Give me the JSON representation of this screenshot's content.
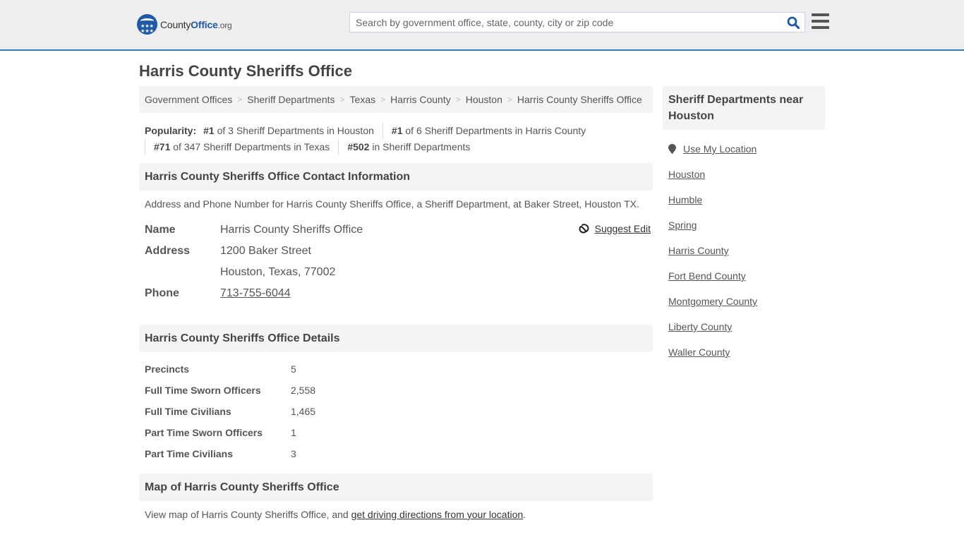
{
  "header": {
    "logo": {
      "prefix": "County",
      "bold": "Office",
      "suffix": ".org"
    },
    "search": {
      "placeholder": "Search by government office, state, county, city or zip code",
      "value": ""
    },
    "icons": {
      "search": "search-icon",
      "menu": "hamburger-menu-icon",
      "logo": "eagle-stars-logo-icon"
    }
  },
  "page": {
    "title": "Harris County Sheriffs Office"
  },
  "breadcrumb": [
    {
      "label": "Government Offices"
    },
    {
      "label": "Sheriff Departments"
    },
    {
      "label": "Texas"
    },
    {
      "label": "Harris County"
    },
    {
      "label": "Houston"
    },
    {
      "label": "Harris County Sheriffs Office"
    }
  ],
  "breadcrumb_separator": ">",
  "popularity": {
    "label": "Popularity:",
    "items": [
      {
        "rank": "#1",
        "text": " of 3 Sheriff Departments in Houston"
      },
      {
        "rank": "#1",
        "text": " of 6 Sheriff Departments in Harris County"
      },
      {
        "rank": "#71",
        "text": " of 347 Sheriff Departments in Texas"
      },
      {
        "rank": "#502",
        "text": " in Sheriff Departments"
      }
    ]
  },
  "contact": {
    "heading": "Harris County Sheriffs Office Contact Information",
    "description": "Address and Phone Number for Harris County Sheriffs Office, a Sheriff Department, at Baker Street, Houston TX.",
    "suggest_edit": "Suggest Edit",
    "name_label": "Name",
    "name_value": "Harris County Sheriffs Office",
    "address_label": "Address",
    "address_line1": "1200 Baker Street",
    "address_line2": "Houston, Texas, 77002",
    "phone_label": "Phone",
    "phone_value": "713-755-6044"
  },
  "details": {
    "heading": "Harris County Sheriffs Office Details",
    "rows": [
      {
        "label": "Precincts",
        "value": "5"
      },
      {
        "label": "Full Time Sworn Officers",
        "value": "2,558"
      },
      {
        "label": "Full Time Civilians",
        "value": "1,465"
      },
      {
        "label": "Part Time Sworn Officers",
        "value": "1"
      },
      {
        "label": "Part Time Civilians",
        "value": "3"
      }
    ]
  },
  "map": {
    "heading": "Map of Harris County Sheriffs Office",
    "text_before": "View map of Harris County Sheriffs Office, and ",
    "link": "get driving directions from your location",
    "text_after": "."
  },
  "sidebar": {
    "heading": "Sheriff Departments near Houston",
    "use_location": "Use My Location",
    "links": [
      {
        "label": "Houston"
      },
      {
        "label": "Humble"
      },
      {
        "label": "Spring"
      },
      {
        "label": "Harris County"
      },
      {
        "label": "Fort Bend County"
      },
      {
        "label": "Montgomery County"
      },
      {
        "label": "Liberty County"
      },
      {
        "label": "Waller County"
      }
    ]
  },
  "colors": {
    "brand_blue": "#1e5aa8",
    "header_bg": "#eeeeee",
    "header_border": "#337ab7",
    "panel_bg": "#f4f4f4",
    "text": "#555555"
  }
}
